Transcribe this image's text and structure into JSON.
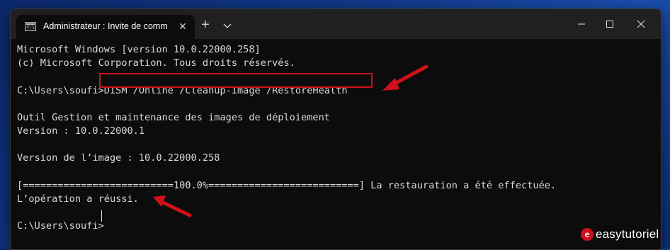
{
  "window": {
    "tab_title": "Administrateur : Invite de comm",
    "tab_icon_text": "C:\\",
    "close_tab": "✕",
    "new_tab": "+"
  },
  "terminal": {
    "lines": [
      "Microsoft Windows [version 10.0.22000.258]",
      "(c) Microsoft Corporation. Tous droits réservés.",
      "",
      "C:\\Users\\soufi>",
      "",
      "Outil Gestion et maintenance des images de déploiement",
      "Version : 10.0.22000.1",
      "",
      "Version de l’image : 10.0.22000.258",
      "",
      "[==========================100.0%==========================] La restauration a été effectuée.",
      "L’opération a réussi.",
      "",
      "C:\\Users\\soufi>"
    ],
    "command": "DISM /Online /Cleanup-Image /RestoreHealth"
  },
  "colors": {
    "accent": "#d0101a",
    "terminal_bg": "#0c0c0c",
    "titlebar_bg": "#202020",
    "text": "#d9d9d9"
  },
  "watermark": {
    "logo": "e",
    "text": "easytutoriel"
  }
}
